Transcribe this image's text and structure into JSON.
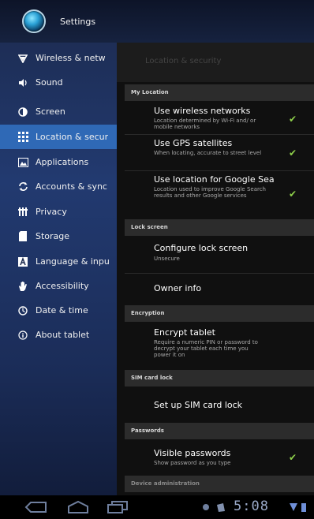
{
  "title_bar": {
    "title": "Settings"
  },
  "sidebar": {
    "items": [
      {
        "label": "Wireless & netw",
        "icon": "wifi-icon"
      },
      {
        "label": "Sound",
        "icon": "speaker-icon"
      },
      {
        "label": "Screen",
        "icon": "screen-icon"
      },
      {
        "label": "Location & secur",
        "icon": "location-grid-icon",
        "selected": true
      },
      {
        "label": "Applications",
        "icon": "applications-icon"
      },
      {
        "label": "Accounts & sync",
        "icon": "sync-icon"
      },
      {
        "label": "Privacy",
        "icon": "privacy-icon"
      },
      {
        "label": "Storage",
        "icon": "storage-icon"
      },
      {
        "label": "Language & inpu",
        "icon": "language-icon"
      },
      {
        "label": "Accessibility",
        "icon": "hand-icon"
      },
      {
        "label": "Date & time",
        "icon": "clock-icon"
      },
      {
        "label": "About tablet",
        "icon": "info-icon"
      }
    ]
  },
  "panel": {
    "title": "Location & security",
    "sections": {
      "my_location": "My Location",
      "lock_screen": "Lock screen",
      "encryption": "Encryption",
      "sim_card_lock": "SIM card lock",
      "passwords": "Passwords",
      "device_admin": "Device administration"
    },
    "prefs": {
      "wireless_networks": {
        "title": "Use wireless networks",
        "summary": "Location determined by Wi-Fi and/ or mobile networks",
        "checked": true
      },
      "gps": {
        "title": "Use GPS satellites",
        "summary": "When locating, accurate to street level",
        "checked": true
      },
      "google_search": {
        "title": "Use location for Google Sea",
        "summary": "Location used to improve Google Search results and other Google services",
        "checked": true
      },
      "configure_lock": {
        "title": "Configure lock screen",
        "summary": "Unsecure"
      },
      "owner_info": {
        "title": "Owner info"
      },
      "encrypt_tablet": {
        "title": "Encrypt tablet",
        "summary": "Require a numeric PIN or password to decrypt your tablet each time you power it on"
      },
      "sim_lock": {
        "title": "Set up SIM card lock"
      },
      "visible_passwords": {
        "title": "Visible passwords",
        "summary": "Show password as you type",
        "checked": true
      }
    }
  },
  "navbar": {
    "clock": "5:08",
    "buttons": [
      "back-icon",
      "home-icon",
      "recent-apps-icon"
    ],
    "status_icons": [
      "notification-icon",
      "bag-icon",
      "wifi-signal-icon",
      "battery-icon"
    ]
  },
  "colors": {
    "selected": "#2f69b6",
    "check": "#8fd14b",
    "panel_bg": "#101010"
  }
}
